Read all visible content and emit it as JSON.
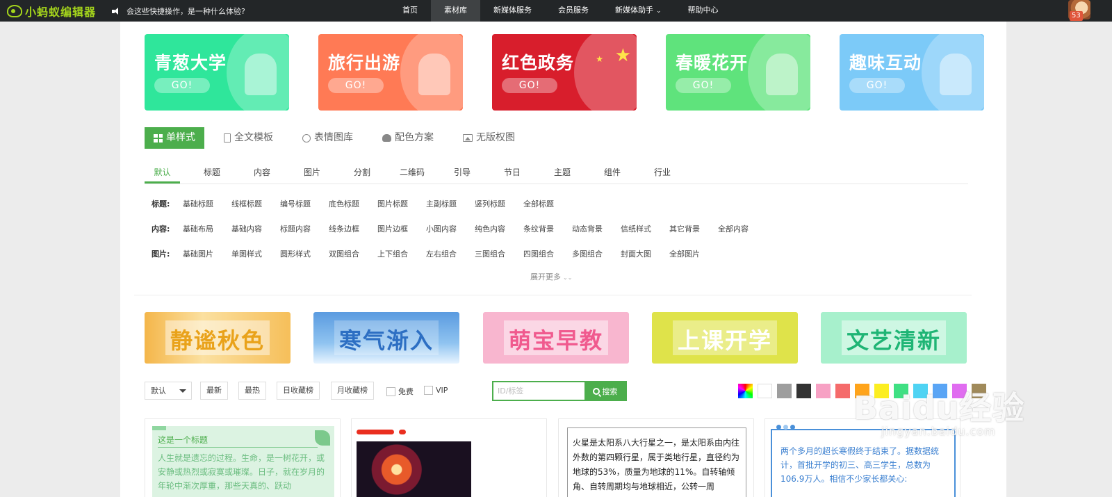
{
  "topbar": {
    "logo_text": "小蚂蚁编辑器",
    "notice": "会这些快捷操作，是一种什么体验?",
    "nav": [
      {
        "label": "首页"
      },
      {
        "label": "素材库"
      },
      {
        "label": "新媒体服务"
      },
      {
        "label": "会员服务"
      },
      {
        "label": "新媒体助手"
      },
      {
        "label": "帮助中心"
      }
    ],
    "active_nav": "素材库",
    "badge_count": "53"
  },
  "banners": [
    {
      "title": "青葱大学",
      "go": "GO!",
      "color": "#2fe69b"
    },
    {
      "title": "旅行出游",
      "go": "GO!",
      "color": "#ff7a55"
    },
    {
      "title": "红色政务",
      "go": "GO!",
      "color": "#d81e2c"
    },
    {
      "title": "春暖花开",
      "go": "GO!",
      "color": "#5fe37c"
    },
    {
      "title": "趣味互动",
      "go": "GO!",
      "color": "#7ccaf8"
    }
  ],
  "category_tabs": [
    {
      "label": "单样式",
      "icon": "grid-icon"
    },
    {
      "label": "全文模板",
      "icon": "document-icon"
    },
    {
      "label": "表情图库",
      "icon": "smile-icon"
    },
    {
      "label": "配色方案",
      "icon": "palette-icon"
    },
    {
      "label": "无版权图",
      "icon": "image-icon"
    }
  ],
  "sub_tabs": [
    "默认",
    "标题",
    "内容",
    "图片",
    "分割",
    "二维码",
    "引导",
    "节日",
    "主题",
    "组件",
    "行业"
  ],
  "filters": {
    "title_row": {
      "label": "标题:",
      "items": [
        "基础标题",
        "线框标题",
        "编号标题",
        "底色标题",
        "图片标题",
        "主副标题",
        "竖列标题",
        "全部标题"
      ]
    },
    "content_row": {
      "label": "内容:",
      "items": [
        "基础布局",
        "基础内容",
        "标题内容",
        "线条边框",
        "图片边框",
        "小图内容",
        "纯色内容",
        "条纹背景",
        "动态背景",
        "信纸样式",
        "其它背景",
        "全部内容"
      ]
    },
    "image_row": {
      "label": "图片:",
      "items": [
        "基础图片",
        "单图样式",
        "圆形样式",
        "双图组合",
        "上下组合",
        "左右组合",
        "三图组合",
        "四图组合",
        "多图组合",
        "封面大图",
        "全部图片"
      ]
    },
    "expand_label": "展开更多"
  },
  "theme_banners": [
    "静谧秋色",
    "寒气渐入",
    "萌宝早教",
    "上课开学",
    "文艺清新"
  ],
  "toolbar": {
    "sort_value": "默认",
    "buttons": [
      "最新",
      "最热",
      "日收藏榜",
      "月收藏榜"
    ],
    "checkbox_free": "免费",
    "checkbox_vip": "VIP",
    "search_placeholder": "ID/标签",
    "search_button": "搜索",
    "swatches": [
      "rainbow",
      "#ffffff",
      "#9e9e9e",
      "#333333",
      "#f7a1c4",
      "#f56b6b",
      "#ffa41b",
      "#fcee21",
      "#3fe083",
      "#4fd3f3",
      "#5aa5f5",
      "#e06cf0",
      "#a08a5a"
    ]
  },
  "cards": {
    "card1": {
      "title": "这是一个标题",
      "body": "人生就是遗忘的过程。生命，是一树花开，或安静或热烈或寂寞或璀璨。日子，就在岁月的年轮中渐次厚重，那些天真的、跃动"
    },
    "card3": {
      "body": "火星是太阳系八大行星之一，是太阳系由内往外数的第四颗行星，属于类地行星，直径约为地球的53%，质量为地球的11%。自转轴倾角、自转周期均与地球相近，公转一周"
    },
    "card4": {
      "body": "两个多月的超长寒假终于结束了。据数据统计，首批开学的初三、高三学生，总数为106.9万人。相信不少家长都关心:"
    }
  },
  "watermark": {
    "main": "Baidu经验",
    "sub": "jingyan.baidu.com"
  }
}
